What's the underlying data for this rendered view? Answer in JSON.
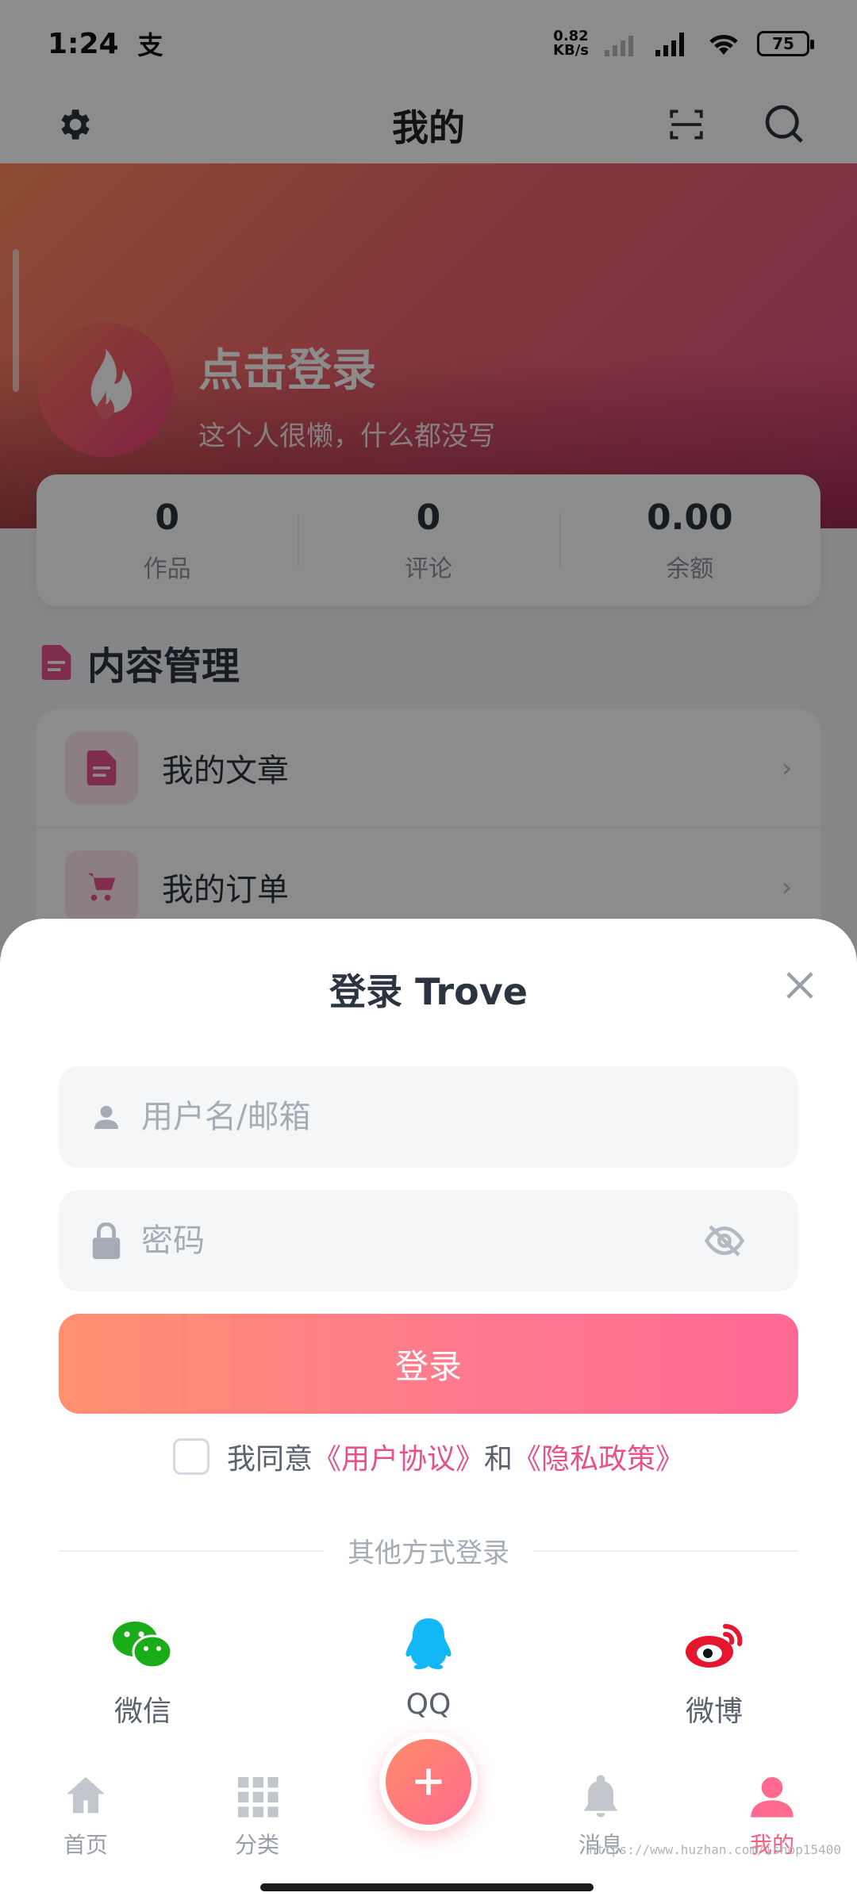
{
  "status_bar": {
    "time": "1:24",
    "ime_indicator": "支",
    "speed_value": "0.82",
    "speed_unit": "KB/s",
    "battery": "75"
  },
  "navbar": {
    "title": "我的",
    "left_icon": "gear-icon",
    "scan_icon": "scan-icon",
    "search_icon": "search-icon"
  },
  "hero": {
    "title": "点击登录",
    "subtitle": "这个人很懒，什么都没写"
  },
  "stats": [
    {
      "value": "0",
      "label": "作品"
    },
    {
      "value": "0",
      "label": "评论"
    },
    {
      "value": "0.00",
      "label": "余额"
    }
  ],
  "section": {
    "title": "内容管理",
    "items": [
      {
        "label": "我的文章",
        "icon": "document-icon"
      },
      {
        "label": "我的订单",
        "icon": "cart-icon"
      }
    ]
  },
  "login_sheet": {
    "title": "登录 Trove",
    "username_placeholder": "用户名/邮箱",
    "password_placeholder": "密码",
    "login_button": "登录",
    "agree_prefix": "我同意",
    "user_agreement": "《用户协议》",
    "and_text": "和",
    "privacy_policy": "《隐私政策》",
    "other_methods": "其他方式登录",
    "socials": [
      {
        "label": "微信",
        "icon": "wechat-icon"
      },
      {
        "label": "QQ",
        "icon": "qq-icon"
      },
      {
        "label": "微博",
        "icon": "weibo-icon"
      }
    ]
  },
  "tabbar": {
    "tabs": [
      {
        "label": "首页",
        "icon": "home-icon"
      },
      {
        "label": "分类",
        "icon": "grid-icon"
      },
      {
        "label": "消息",
        "icon": "bell-icon"
      },
      {
        "label": "我的",
        "icon": "user-icon"
      }
    ],
    "fab_icon": "plus-icon"
  },
  "watermark": "https://www.huzhan.com/ishop15400",
  "colors": {
    "accent": "#ff6a8e",
    "link": "#e8508c",
    "wechat": "#1aad19",
    "qq": "#12b7f5",
    "weibo": "#e6162d"
  }
}
